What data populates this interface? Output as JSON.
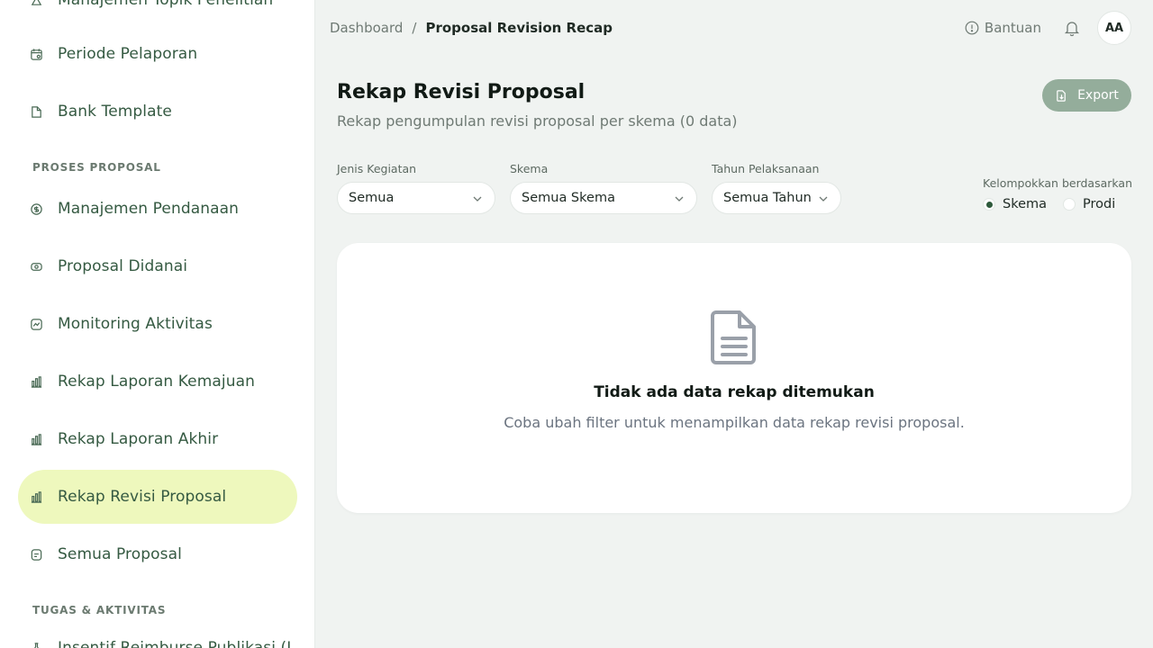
{
  "sidebar": {
    "items": [
      {
        "label": "Manajemen Topik Penelitian",
        "icon": "flask-icon"
      },
      {
        "label": "Periode Pelaporan",
        "icon": "calendar-icon"
      },
      {
        "label": "Bank Template",
        "icon": "file-icon"
      },
      {
        "label": "Manajemen Pendanaan",
        "icon": "coin-icon"
      },
      {
        "label": "Proposal Didanai",
        "icon": "money-icon"
      },
      {
        "label": "Monitoring Aktivitas",
        "icon": "activity-icon"
      },
      {
        "label": "Rekap Laporan Kemajuan",
        "icon": "bar-chart-icon"
      },
      {
        "label": "Rekap Laporan Akhir",
        "icon": "bar-chart-icon"
      },
      {
        "label": "Rekap Revisi Proposal",
        "icon": "bar-chart-icon",
        "active": true
      },
      {
        "label": "Semua Proposal",
        "icon": "document-icon"
      },
      {
        "label": "Insentif Reimburse Publikasi (L",
        "icon": "flask-icon"
      }
    ],
    "sections": {
      "proses": "PROSES PROPOSAL",
      "tugas": "TUGAS & AKTIVITAS"
    }
  },
  "header": {
    "breadcrumb_root": "Dashboard",
    "breadcrumb_sep": "/",
    "breadcrumb_current": "Proposal Revision Recap",
    "help_label": "Bantuan",
    "avatar_initials": "AA"
  },
  "page": {
    "title": "Rekap Revisi Proposal",
    "subtitle": "Rekap pengumpulan revisi proposal per skema (0 data)",
    "export_label": "Export"
  },
  "filters": {
    "jenis": {
      "label": "Jenis Kegiatan",
      "value": "Semua"
    },
    "skema": {
      "label": "Skema",
      "value": "Semua Skema"
    },
    "tahun": {
      "label": "Tahun Pelaksanaan",
      "value": "Semua Tahun"
    },
    "group_by": {
      "label": "Kelompokkan berdasarkan",
      "options": [
        "Skema",
        "Prodi"
      ],
      "selected": "Skema"
    }
  },
  "empty_state": {
    "title": "Tidak ada data rekap ditemukan",
    "description": "Coba ubah filter untuk menampilkan data rekap revisi proposal."
  },
  "colors": {
    "active_nav_bg": "#eef8bd",
    "accent_green": "#2e5a3c",
    "export_bg": "#94ad9b"
  }
}
